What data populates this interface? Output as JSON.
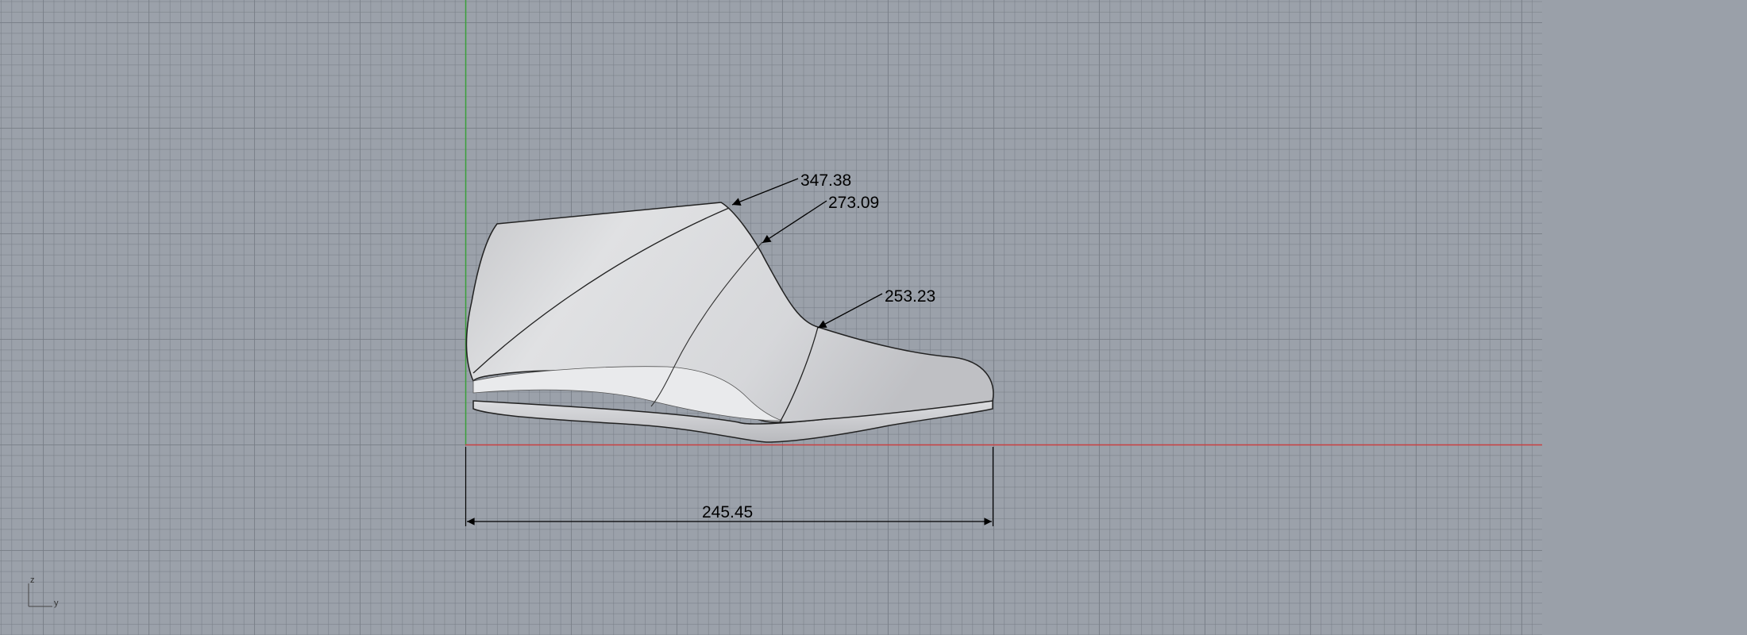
{
  "viewport": {
    "grid_color": "#7f858e",
    "background_color": "#9ba1aa",
    "x_axis_color": "#c94040",
    "y_axis_color": "#3aa03a"
  },
  "dimensions": {
    "heel_top": "347.38",
    "instep": "273.09",
    "toe_joint": "253.23",
    "length": "245.45"
  },
  "axis_indicator": {
    "vertical": "z",
    "horizontal": "y"
  },
  "object": {
    "icon": "shoe-last-model",
    "surface_color": "#d4d5d8"
  }
}
